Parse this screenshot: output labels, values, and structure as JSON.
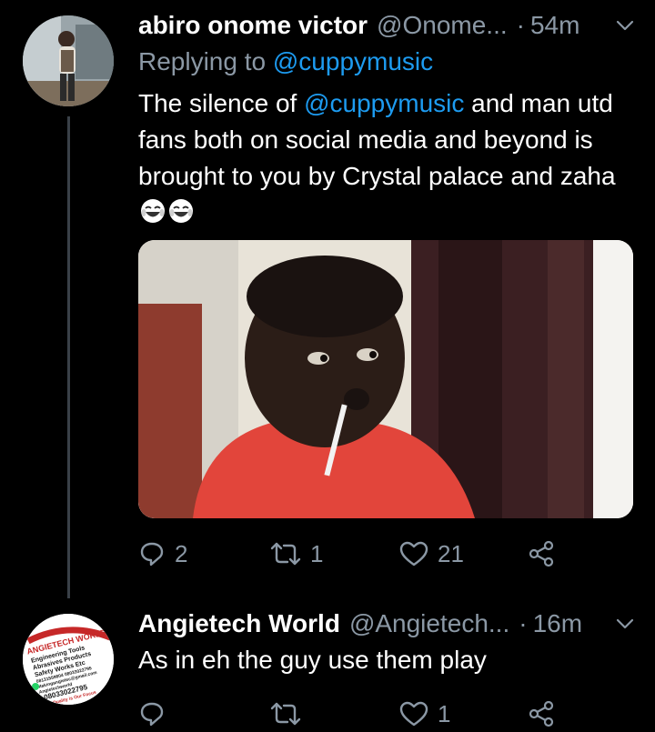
{
  "tweets": [
    {
      "name": "abiro onome victor",
      "handle": "@Onome...",
      "dot": "·",
      "time": "54m",
      "replying_prefix": "Replying to",
      "replying_handle": "@cuppymusic",
      "text_before": "The silence of",
      "text_mention": "@cuppymusic",
      "text_after": "and man utd fans both on social media and beyond is brought to you by Crystal palace and zaha",
      "emojis": [
        "face-with-tears-of-joy",
        "face-with-tears-of-joy"
      ],
      "reply_count": "2",
      "retweet_count": "1",
      "like_count": "21"
    },
    {
      "name": "Angietech World",
      "handle": "@Angietech...",
      "dot": "·",
      "time": "16m",
      "text": "As in eh the guy use them play",
      "reply_count": "",
      "retweet_count": "",
      "like_count": "1",
      "avatar_logo_text": [
        "ANGIETECH WORLD",
        "Engineering Tools",
        "Abrasives Products",
        "Safety Works Etc",
        "08131559804 08033022795",
        "Makingangietec@gmail.com",
        "Angietechworld",
        "08033022795",
        "Quality is Our Focus"
      ]
    }
  ],
  "colors": {
    "background": "#000000",
    "primary_text": "#ffffff",
    "secondary_text": "#8b98a5",
    "link": "#1d9bf0",
    "thread_line": "#3a4148"
  },
  "icons": [
    "chevron-down-icon",
    "reply-icon",
    "retweet-icon",
    "like-icon",
    "share-icon"
  ]
}
